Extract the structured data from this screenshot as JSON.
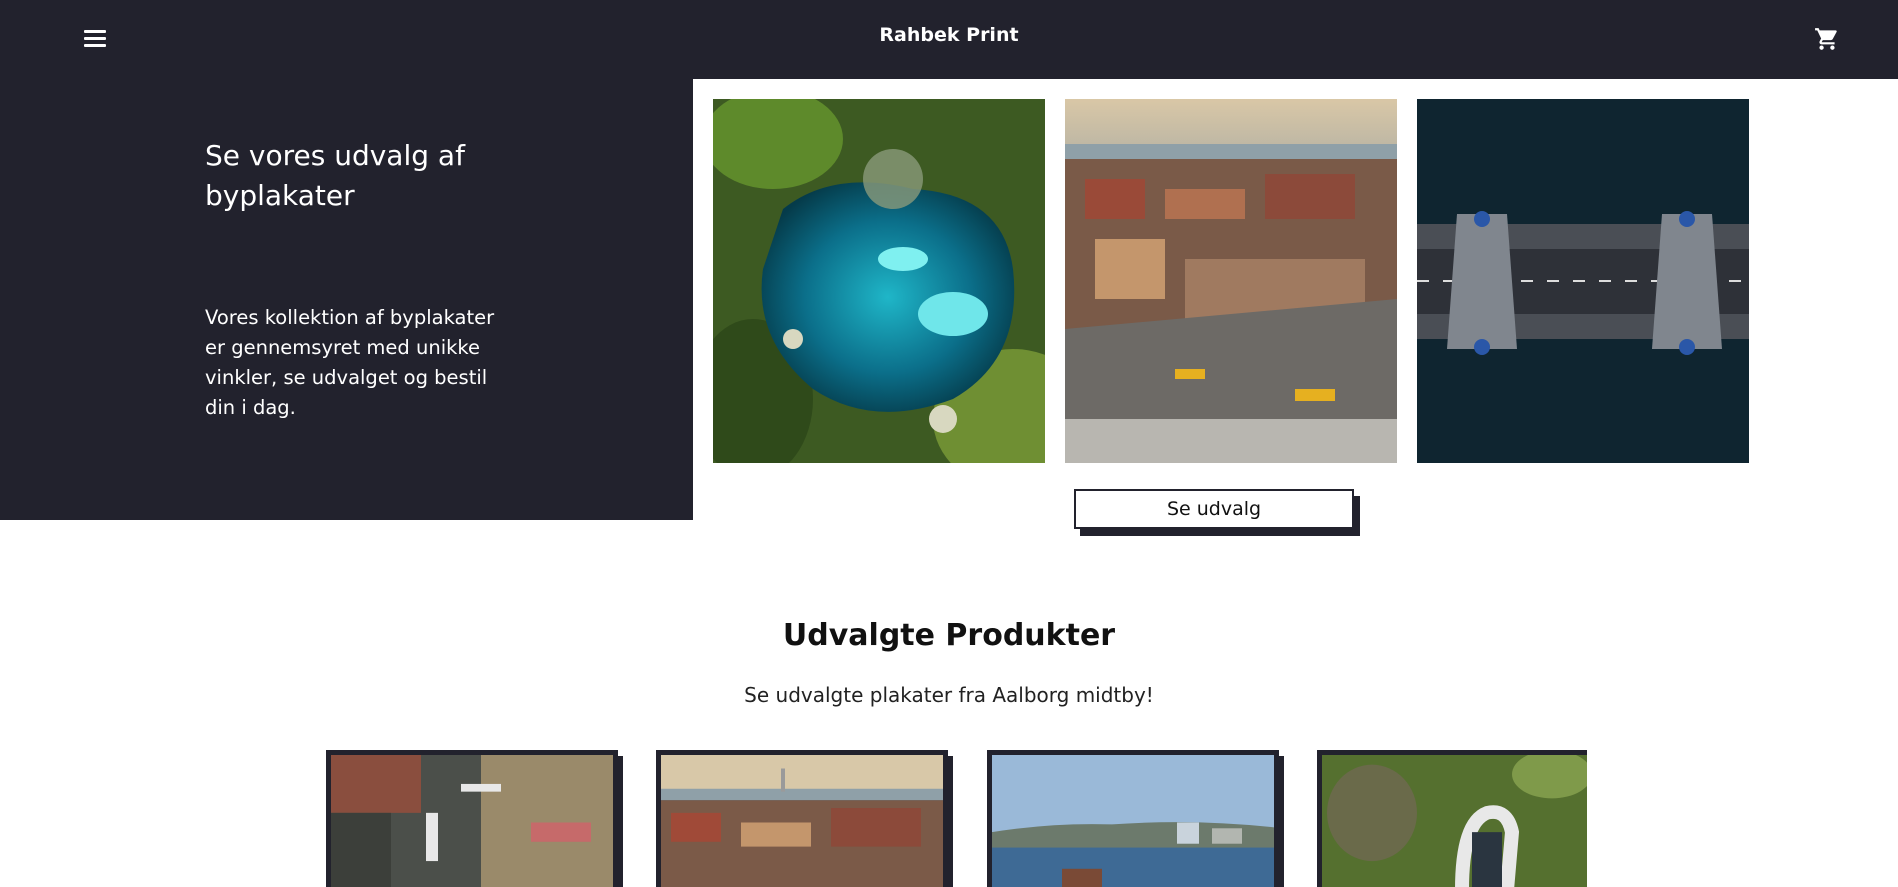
{
  "header": {
    "brand": "Rahbek Print",
    "menu_icon": "hamburger-menu-icon",
    "cart_icon": "shopping-cart-icon"
  },
  "hero": {
    "title": "Se vores udvalg af byplakater",
    "text": "Vores kollektion af byplakater er gennemsyret med unikke vinkler, se udvalget og bestil din i dag.",
    "cta_label": "Se udvalg",
    "photos": [
      {
        "subject": "aerial lake"
      },
      {
        "subject": "aerial city square"
      },
      {
        "subject": "aerial bridge"
      }
    ]
  },
  "featured": {
    "title": "Udvalgte Produkter",
    "subtitle": "Se udvalgte plakater fra Aalborg midtby!",
    "products": [
      {
        "subject": "aerial street crossing"
      },
      {
        "subject": "aerial city skyline"
      },
      {
        "subject": "harbour waterfront"
      },
      {
        "subject": "aerial park sculpture"
      }
    ]
  },
  "colors": {
    "dark": "#22222d",
    "light": "#ffffff"
  }
}
